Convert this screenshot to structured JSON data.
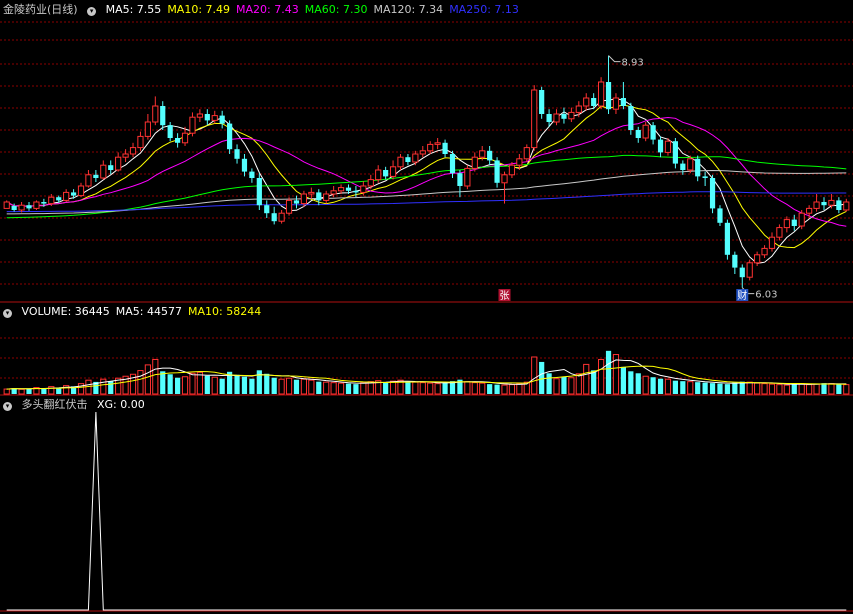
{
  "panels": {
    "price": {
      "title": "金陵药业(日线)",
      "indicators": [
        {
          "label": "MA5: 7.55",
          "color": "#ffffff"
        },
        {
          "label": "MA10: 7.49",
          "color": "#ffff00"
        },
        {
          "label": "MA20: 7.43",
          "color": "#ff00ff"
        },
        {
          "label": "MA60: 7.30",
          "color": "#00ff00"
        },
        {
          "label": "MA120: 7.34",
          "color": "#c8c8c8"
        },
        {
          "label": "MA250: 7.13",
          "color": "#3030ff"
        }
      ],
      "high_label": "8.93",
      "low_label": "6.03",
      "markers": [
        "张",
        "财"
      ]
    },
    "volume": {
      "indicators": [
        {
          "label": "VOLUME: 36445",
          "color": "#ffffff"
        },
        {
          "label": "MA5: 44577",
          "color": "#ffffff"
        },
        {
          "label": "MA10: 58244",
          "color": "#ffff00"
        }
      ]
    },
    "signal": {
      "title": "多头翻红伏击",
      "indicators": [
        {
          "label": "XG: 0.00",
          "color": "#ffffff"
        }
      ]
    }
  },
  "colors": {
    "up": "#ff3232",
    "down": "#54ffff",
    "grid": "#8b0000",
    "divider": "#b01010"
  },
  "chart_data": [
    {
      "type": "candlestick",
      "title": "金陵药业(日线)",
      "ylim": [
        5.9,
        9.4
      ],
      "series": [
        {
          "name": "MA5",
          "value": 7.55
        },
        {
          "name": "MA10",
          "value": 7.49
        },
        {
          "name": "MA20",
          "value": 7.43
        },
        {
          "name": "MA60",
          "value": 7.3
        },
        {
          "name": "MA120",
          "value": 7.34
        },
        {
          "name": "MA250",
          "value": 7.13
        }
      ],
      "annotations": [
        "8.93",
        "6.03"
      ],
      "candles": [
        [
          7.02,
          7.1,
          7.05,
          7.12
        ],
        [
          7.05,
          7.0,
          6.98,
          7.08
        ],
        [
          7.0,
          7.06,
          6.97,
          7.1
        ],
        [
          7.06,
          7.02,
          6.99,
          7.1
        ],
        [
          7.02,
          7.1,
          7.0,
          7.12
        ],
        [
          7.1,
          7.08,
          7.04,
          7.14
        ],
        [
          7.08,
          7.16,
          7.05,
          7.2
        ],
        [
          7.16,
          7.12,
          7.09,
          7.18
        ],
        [
          7.12,
          7.22,
          7.1,
          7.26
        ],
        [
          7.22,
          7.18,
          7.14,
          7.26
        ],
        [
          7.18,
          7.3,
          7.16,
          7.34
        ],
        [
          7.3,
          7.44,
          7.28,
          7.5
        ],
        [
          7.44,
          7.4,
          7.35,
          7.5
        ],
        [
          7.4,
          7.56,
          7.38,
          7.62
        ],
        [
          7.56,
          7.5,
          7.45,
          7.62
        ],
        [
          7.5,
          7.66,
          7.48,
          7.72
        ],
        [
          7.66,
          7.7,
          7.6,
          7.76
        ],
        [
          7.7,
          7.78,
          7.66,
          7.84
        ],
        [
          7.78,
          7.92,
          7.74,
          7.98
        ],
        [
          7.92,
          8.1,
          7.88,
          8.2
        ],
        [
          8.1,
          8.3,
          8.06,
          8.42
        ],
        [
          8.3,
          8.06,
          8.0,
          8.36
        ],
        [
          8.06,
          7.9,
          7.86,
          8.1
        ],
        [
          7.9,
          7.84,
          7.78,
          7.96
        ],
        [
          7.84,
          7.96,
          7.8,
          8.04
        ],
        [
          7.96,
          8.16,
          7.92,
          8.22
        ],
        [
          8.16,
          8.2,
          8.1,
          8.26
        ],
        [
          8.2,
          8.12,
          8.06,
          8.26
        ],
        [
          8.12,
          8.18,
          8.08,
          8.24
        ],
        [
          8.18,
          8.08,
          8.02,
          8.24
        ],
        [
          8.08,
          7.76,
          7.7,
          8.12
        ],
        [
          7.76,
          7.64,
          7.58,
          7.82
        ],
        [
          7.64,
          7.48,
          7.42,
          7.7
        ],
        [
          7.48,
          7.4,
          7.34,
          7.52
        ],
        [
          7.4,
          7.06,
          7.0,
          7.46
        ],
        [
          7.06,
          6.96,
          6.9,
          7.12
        ],
        [
          6.96,
          6.86,
          6.82,
          7.04
        ],
        [
          6.86,
          6.96,
          6.83,
          7.0
        ],
        [
          6.96,
          7.12,
          6.93,
          7.16
        ],
        [
          7.12,
          7.08,
          7.02,
          7.18
        ],
        [
          7.08,
          7.2,
          7.04,
          7.24
        ],
        [
          7.2,
          7.22,
          7.14,
          7.28
        ],
        [
          7.22,
          7.12,
          7.06,
          7.26
        ],
        [
          7.12,
          7.2,
          7.08,
          7.24
        ],
        [
          7.2,
          7.24,
          7.16,
          7.3
        ],
        [
          7.24,
          7.28,
          7.2,
          7.32
        ],
        [
          7.28,
          7.24,
          7.2,
          7.32
        ],
        [
          7.24,
          7.22,
          7.16,
          7.3
        ],
        [
          7.22,
          7.3,
          7.18,
          7.36
        ],
        [
          7.3,
          7.38,
          7.26,
          7.44
        ],
        [
          7.38,
          7.5,
          7.34,
          7.56
        ],
        [
          7.5,
          7.42,
          7.38,
          7.54
        ],
        [
          7.42,
          7.54,
          7.38,
          7.62
        ],
        [
          7.54,
          7.66,
          7.5,
          7.7
        ],
        [
          7.66,
          7.6,
          7.56,
          7.7
        ],
        [
          7.6,
          7.7,
          7.56,
          7.74
        ],
        [
          7.7,
          7.74,
          7.66,
          7.8
        ],
        [
          7.74,
          7.82,
          7.7,
          7.86
        ],
        [
          7.82,
          7.84,
          7.76,
          7.9
        ],
        [
          7.84,
          7.7,
          7.66,
          7.88
        ],
        [
          7.7,
          7.46,
          7.4,
          7.74
        ],
        [
          7.46,
          7.3,
          7.16,
          7.5
        ],
        [
          7.3,
          7.52,
          7.26,
          7.56
        ],
        [
          7.52,
          7.66,
          7.48,
          7.72
        ],
        [
          7.66,
          7.74,
          7.62,
          7.8
        ],
        [
          7.74,
          7.62,
          7.56,
          7.8
        ],
        [
          7.62,
          7.34,
          7.28,
          7.66
        ],
        [
          7.34,
          7.44,
          7.08,
          7.48
        ],
        [
          7.44,
          7.56,
          7.4,
          7.6
        ],
        [
          7.56,
          7.64,
          7.5,
          7.7
        ],
        [
          7.64,
          7.78,
          7.6,
          7.82
        ],
        [
          7.78,
          8.5,
          7.74,
          8.56
        ],
        [
          8.5,
          8.2,
          8.14,
          8.54
        ],
        [
          8.2,
          8.1,
          8.04,
          8.26
        ],
        [
          8.1,
          8.2,
          8.06,
          8.26
        ],
        [
          8.2,
          8.14,
          8.08,
          8.28
        ],
        [
          8.14,
          8.22,
          8.1,
          8.28
        ],
        [
          8.22,
          8.3,
          8.16,
          8.36
        ],
        [
          8.3,
          8.4,
          8.24,
          8.46
        ],
        [
          8.4,
          8.3,
          8.26,
          8.46
        ],
        [
          8.3,
          8.6,
          8.26,
          8.66
        ],
        [
          8.6,
          8.26,
          8.2,
          8.93
        ],
        [
          8.26,
          8.4,
          8.2,
          8.46
        ],
        [
          8.4,
          8.3,
          8.26,
          8.6
        ],
        [
          8.3,
          8.0,
          7.94,
          8.34
        ],
        [
          8.0,
          7.9,
          7.84,
          8.04
        ],
        [
          7.9,
          8.06,
          7.86,
          8.1
        ],
        [
          8.06,
          7.88,
          7.82,
          8.1
        ],
        [
          7.88,
          7.72,
          7.66,
          7.92
        ],
        [
          7.72,
          7.86,
          7.68,
          7.9
        ],
        [
          7.86,
          7.58,
          7.52,
          7.9
        ],
        [
          7.58,
          7.5,
          7.44,
          7.62
        ],
        [
          7.5,
          7.64,
          7.46,
          7.68
        ],
        [
          7.64,
          7.42,
          7.36,
          7.68
        ],
        [
          7.42,
          7.4,
          7.3,
          7.48
        ],
        [
          7.4,
          7.02,
          6.96,
          7.44
        ],
        [
          7.02,
          6.84,
          6.8,
          7.06
        ],
        [
          6.84,
          6.44,
          6.38,
          6.88
        ],
        [
          6.44,
          6.28,
          6.2,
          6.48
        ],
        [
          6.28,
          6.16,
          6.03,
          6.32
        ],
        [
          6.16,
          6.34,
          6.12,
          6.38
        ],
        [
          6.34,
          6.44,
          6.3,
          6.48
        ],
        [
          6.44,
          6.52,
          6.4,
          6.56
        ],
        [
          6.52,
          6.66,
          6.48,
          6.72
        ],
        [
          6.66,
          6.78,
          6.62,
          6.82
        ],
        [
          6.78,
          6.88,
          6.72,
          6.92
        ],
        [
          6.88,
          6.8,
          6.74,
          6.94
        ],
        [
          6.8,
          6.96,
          6.76,
          7.0
        ],
        [
          6.96,
          7.02,
          6.9,
          7.06
        ],
        [
          7.02,
          7.1,
          6.98,
          7.2
        ],
        [
          7.1,
          7.06,
          7.0,
          7.16
        ],
        [
          7.06,
          7.12,
          7.02,
          7.2
        ],
        [
          7.12,
          7.0,
          6.96,
          7.16
        ],
        [
          7.0,
          7.1,
          6.98,
          7.14
        ]
      ]
    },
    {
      "type": "bar",
      "title": "VOLUME",
      "series": [
        {
          "name": "VOLUME",
          "value": 36445
        },
        {
          "name": "MA5",
          "value": 44577
        },
        {
          "name": "MA10",
          "value": 58244
        }
      ],
      "ylim": [
        0,
        300000
      ],
      "values": [
        20000,
        24000,
        19000,
        22000,
        26000,
        21000,
        30000,
        25000,
        34000,
        31000,
        42000,
        56000,
        49000,
        60000,
        52000,
        64000,
        72000,
        80000,
        95000,
        118000,
        140000,
        92000,
        80000,
        66000,
        70000,
        84000,
        88000,
        74000,
        68000,
        62000,
        90000,
        78000,
        70000,
        62000,
        96000,
        82000,
        66000,
        60000,
        64000,
        58000,
        60000,
        56000,
        50000,
        48000,
        46000,
        44000,
        42000,
        40000,
        46000,
        50000,
        54000,
        48000,
        52000,
        56000,
        50000,
        48000,
        46000,
        44000,
        42000,
        46000,
        52000,
        58000,
        50000,
        46000,
        44000,
        40000,
        38000,
        36000,
        38000,
        42000,
        48000,
        150000,
        130000,
        84000,
        62000,
        70000,
        66000,
        82000,
        120000,
        96000,
        140000,
        175000,
        160000,
        110000,
        92000,
        84000,
        72000,
        68000,
        62000,
        60000,
        54000,
        52000,
        50000,
        48000,
        46000,
        44000,
        42000,
        40000,
        46000,
        50000,
        48000,
        44000,
        42000,
        40000,
        38000,
        36000,
        40000,
        42000,
        38000,
        40000,
        44000,
        42000,
        40000,
        38000,
        36445
      ]
    },
    {
      "type": "line",
      "title": "多头翻红伏击",
      "series": [
        {
          "name": "XG",
          "value": 0.0
        }
      ],
      "ylim": [
        0,
        1
      ],
      "signal_index": 12
    }
  ]
}
